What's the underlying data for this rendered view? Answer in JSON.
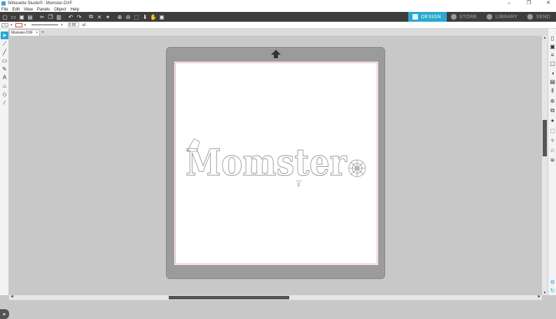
{
  "window": {
    "title": "Silhouette Studio® : Momster-DXF",
    "controls": [
      "–",
      "❐",
      "✕"
    ]
  },
  "menu": [
    "File",
    "Edit",
    "View",
    "Panels",
    "Object",
    "Help"
  ],
  "nav_tabs": [
    {
      "label": "DESIGN",
      "icon": "design-icon",
      "active": true
    },
    {
      "label": "STORE",
      "icon": "store-icon",
      "active": false
    },
    {
      "label": "LIBRARY",
      "icon": "library-icon",
      "active": false
    },
    {
      "label": "SEND",
      "icon": "send-icon",
      "active": false
    }
  ],
  "subtoolbar": {
    "line_width": "0.00"
  },
  "document": {
    "tab_label": "Momster-DXF",
    "close_glyph": "×",
    "add_glyph": "+"
  },
  "design": {
    "text": "Momster"
  },
  "colors": {
    "accent": "#2aa8d2",
    "toolbar_bg": "#3d3d3d",
    "mat": "#9b9b9b",
    "workspace": "#c8c8c8"
  }
}
